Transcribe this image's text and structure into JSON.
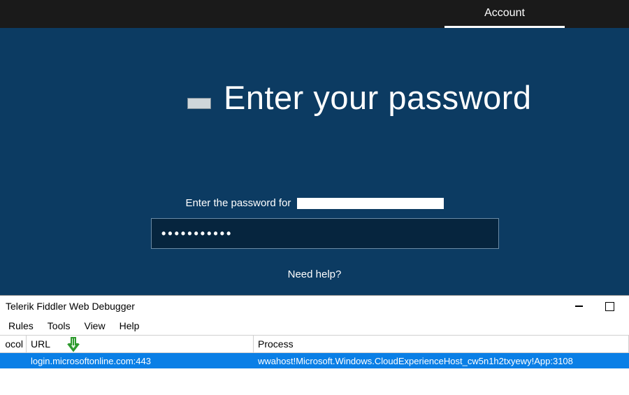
{
  "topbar": {
    "account_tab": "Account"
  },
  "main": {
    "heading": "Enter your password",
    "subtext_prefix": "Enter the password for",
    "password_masked": "•••••••••••",
    "help_link": "Need help?"
  },
  "fiddler": {
    "title": "Telerik Fiddler Web Debugger",
    "menu": {
      "rules": "Rules",
      "tools": "Tools",
      "view": "View",
      "help": "Help"
    },
    "columns": {
      "protocol": "ocol",
      "url": "URL",
      "process": "Process"
    },
    "row": {
      "url": "login.microsoftonline.com:443",
      "process": "wwahost!Microsoft.Windows.CloudExperienceHost_cw5n1h2txyewy!App:3108"
    }
  }
}
